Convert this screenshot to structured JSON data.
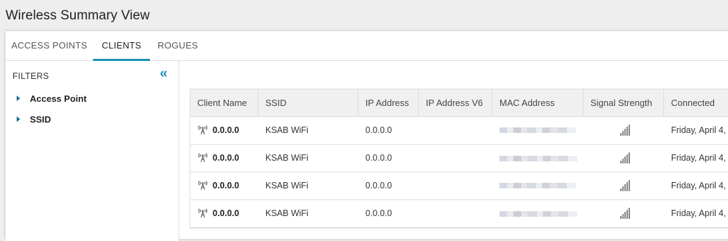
{
  "page": {
    "title": "Wireless Summary View"
  },
  "tabs": [
    {
      "label": "ACCESS POINTS",
      "active": false
    },
    {
      "label": "CLIENTS",
      "active": true
    },
    {
      "label": "ROGUES",
      "active": false
    }
  ],
  "filters": {
    "title": "FILTERS",
    "collapse_icon": "double-chevron-left-icon",
    "items": [
      {
        "label": "Access Point"
      },
      {
        "label": "SSID"
      }
    ]
  },
  "grid": {
    "columns": [
      "Client Name",
      "SSID",
      "IP Address",
      "IP Address V6",
      "MAC Address",
      "Signal Strength",
      "Connected"
    ],
    "rows": [
      {
        "client_name": "0.0.0.0",
        "ssid": "KSAB WiFi",
        "ip": "0.0.0.0",
        "ipv6": "",
        "mac": "[redacted]",
        "signal": "signal-bars-icon",
        "connected": "Friday, April 4,"
      },
      {
        "client_name": "0.0.0.0",
        "ssid": "KSAB WiFi",
        "ip": "0.0.0.0",
        "ipv6": "",
        "mac": "[redacted]",
        "signal": "signal-bars-icon",
        "connected": "Friday, April 4,"
      },
      {
        "client_name": "0.0.0.0",
        "ssid": "KSAB WiFi",
        "ip": "0.0.0.0",
        "ipv6": "",
        "mac": "[redacted]",
        "signal": "signal-bars-icon",
        "connected": "Friday, April 4,"
      },
      {
        "client_name": "0.0.0.0",
        "ssid": "KSAB WiFi",
        "ip": "0.0.0.0",
        "ipv6": "",
        "mac": "[redacted]",
        "signal": "signal-bars-icon",
        "connected": "Friday, April 4,"
      }
    ]
  },
  "colors": {
    "accent": "#1a8fb3",
    "header_bg": "#f0f0f0",
    "page_bg": "#eeeeee"
  }
}
